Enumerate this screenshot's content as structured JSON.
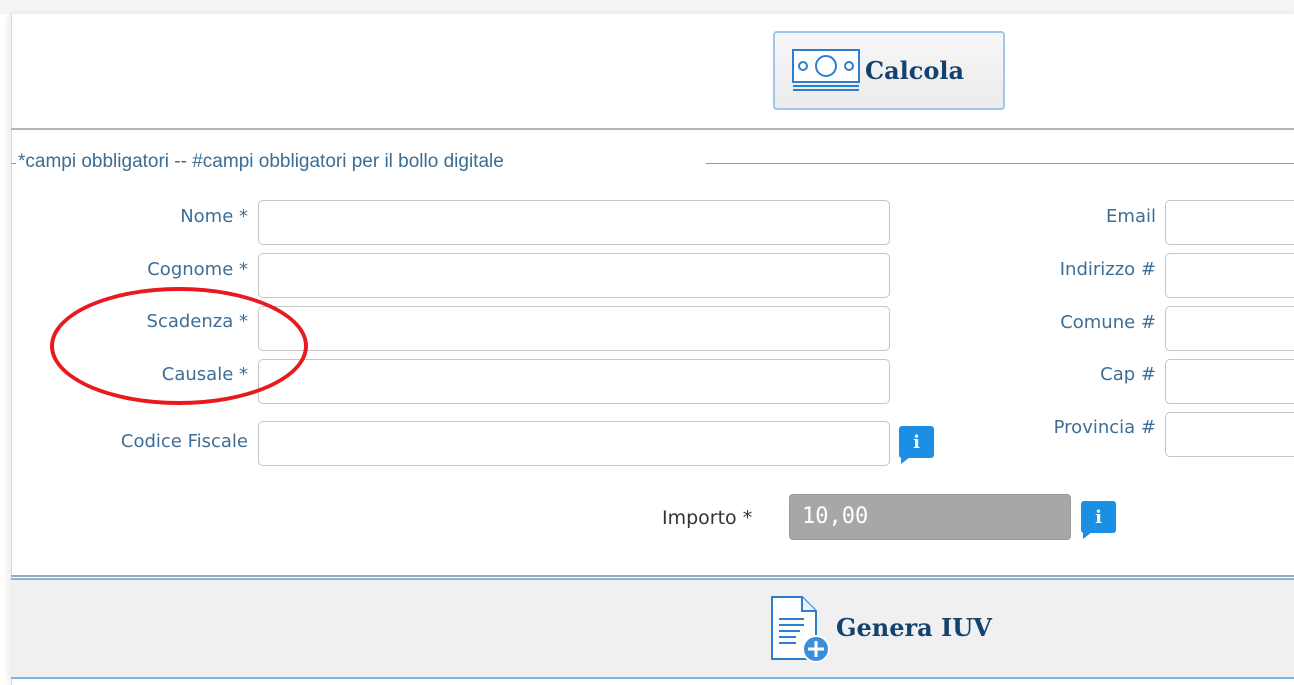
{
  "toolbar": {
    "calcola_label": "Calcola"
  },
  "form": {
    "legend": "*campi obbligatori -- #campi obbligatori per il bollo digitale",
    "left_fields": [
      {
        "label": "Nome *",
        "value": ""
      },
      {
        "label": "Cognome *",
        "value": ""
      },
      {
        "label": "Scadenza *",
        "value": ""
      },
      {
        "label": "Causale *",
        "value": ""
      },
      {
        "label": "Codice Fiscale",
        "value": ""
      }
    ],
    "right_fields": [
      {
        "label": "Email",
        "value": ""
      },
      {
        "label": "Indirizzo #",
        "value": ""
      },
      {
        "label": "Comune #",
        "value": ""
      },
      {
        "label": "Cap #",
        "value": ""
      },
      {
        "label": "Provincia #",
        "value": ""
      }
    ],
    "info_icon_text": "i",
    "importo_label": "Importo *",
    "importo_value": "10,00"
  },
  "footer": {
    "genera_label": "Genera IUV"
  },
  "colors": {
    "label": "#3e6e96",
    "button_text": "#13426e",
    "info_blue": "#1a8fe3",
    "highlight": "#e8191f"
  }
}
